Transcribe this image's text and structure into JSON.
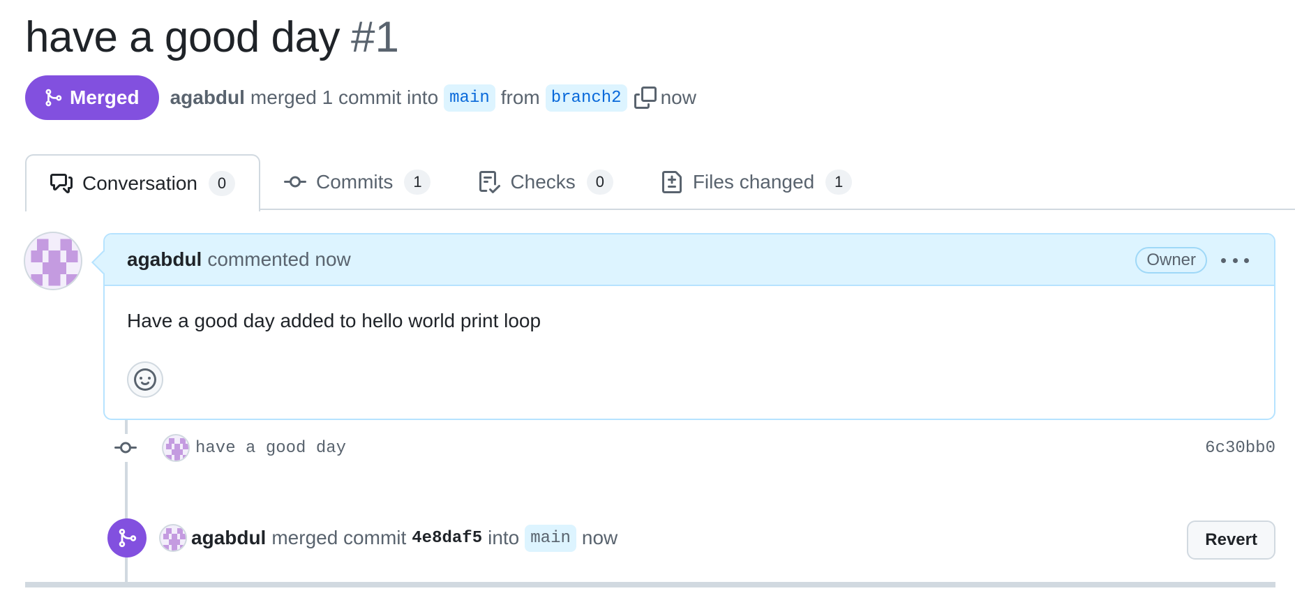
{
  "pr": {
    "title": "have a good day",
    "number": "#1"
  },
  "meta": {
    "state_label": "Merged",
    "author": "agabdul",
    "merged_text": "merged 1 commit into",
    "base_branch": "main",
    "from_text": "from",
    "head_branch": "branch2",
    "time": "now",
    "state_color": "#8250df"
  },
  "tabs": [
    {
      "label": "Conversation",
      "count": "0",
      "icon": "comment-discussion-icon"
    },
    {
      "label": "Commits",
      "count": "1",
      "icon": "git-commit-icon"
    },
    {
      "label": "Checks",
      "count": "0",
      "icon": "checklist-icon"
    },
    {
      "label": "Files changed",
      "count": "1",
      "icon": "file-diff-icon"
    }
  ],
  "comment": {
    "author": "agabdul",
    "action": "commented now",
    "role_badge": "Owner",
    "body": "Have a good day added to hello world print loop"
  },
  "commit": {
    "message": "have a good day",
    "sha": "6c30bb0"
  },
  "merge_event": {
    "author": "agabdul",
    "text_before": "merged commit",
    "sha": "4e8daf5",
    "text_into": "into",
    "branch": "main",
    "time": "now",
    "revert_label": "Revert"
  }
}
